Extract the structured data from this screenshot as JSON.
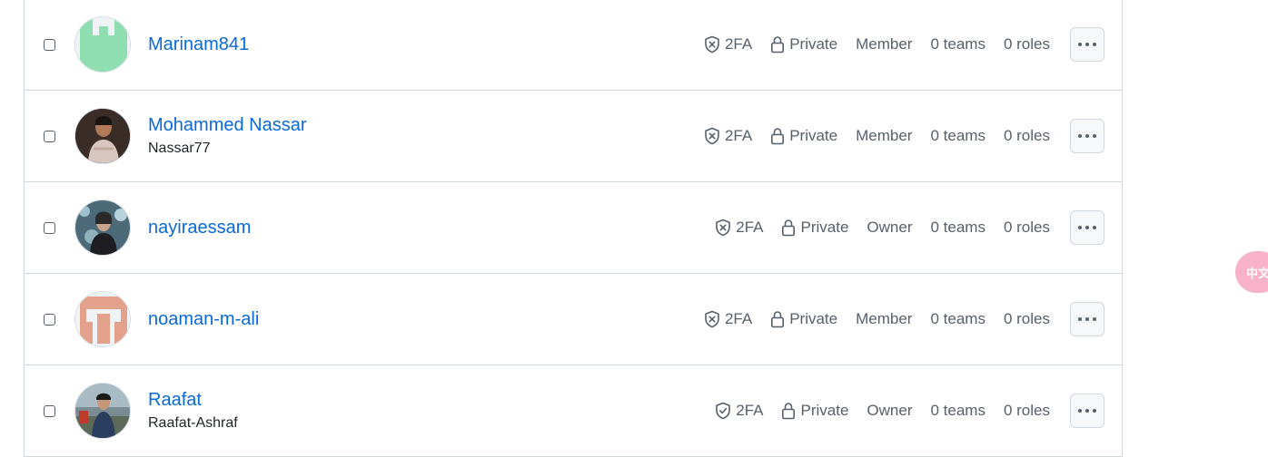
{
  "members": [
    {
      "name": "Marinam841",
      "login": "",
      "twofa_label": "2FA",
      "twofa_status": "disabled",
      "visibility": "Private",
      "role": "Member",
      "teams": "0 teams",
      "roles": "0 roles",
      "avatar_kind": "identicon-green"
    },
    {
      "name": "Mohammed Nassar",
      "login": "Nassar77",
      "twofa_label": "2FA",
      "twofa_status": "disabled",
      "visibility": "Private",
      "role": "Member",
      "teams": "0 teams",
      "roles": "0 roles",
      "avatar_kind": "photo"
    },
    {
      "name": "nayiraessam",
      "login": "",
      "twofa_label": "2FA",
      "twofa_status": "disabled",
      "visibility": "Private",
      "role": "Owner",
      "teams": "0 teams",
      "roles": "0 roles",
      "avatar_kind": "photo"
    },
    {
      "name": "noaman-m-ali",
      "login": "",
      "twofa_label": "2FA",
      "twofa_status": "disabled",
      "visibility": "Private",
      "role": "Member",
      "teams": "0 teams",
      "roles": "0 roles",
      "avatar_kind": "identicon-salmon"
    },
    {
      "name": "Raafat",
      "login": "Raafat-Ashraf",
      "twofa_label": "2FA",
      "twofa_status": "enabled",
      "visibility": "Private",
      "role": "Owner",
      "teams": "0 teams",
      "roles": "0 roles",
      "avatar_kind": "photo"
    }
  ],
  "translate_badge": "中文A",
  "icons": {
    "shield_disabled": "shield-x-icon",
    "shield_enabled": "shield-check-icon",
    "lock": "lock-icon",
    "more": "kebab-horizontal-icon"
  }
}
